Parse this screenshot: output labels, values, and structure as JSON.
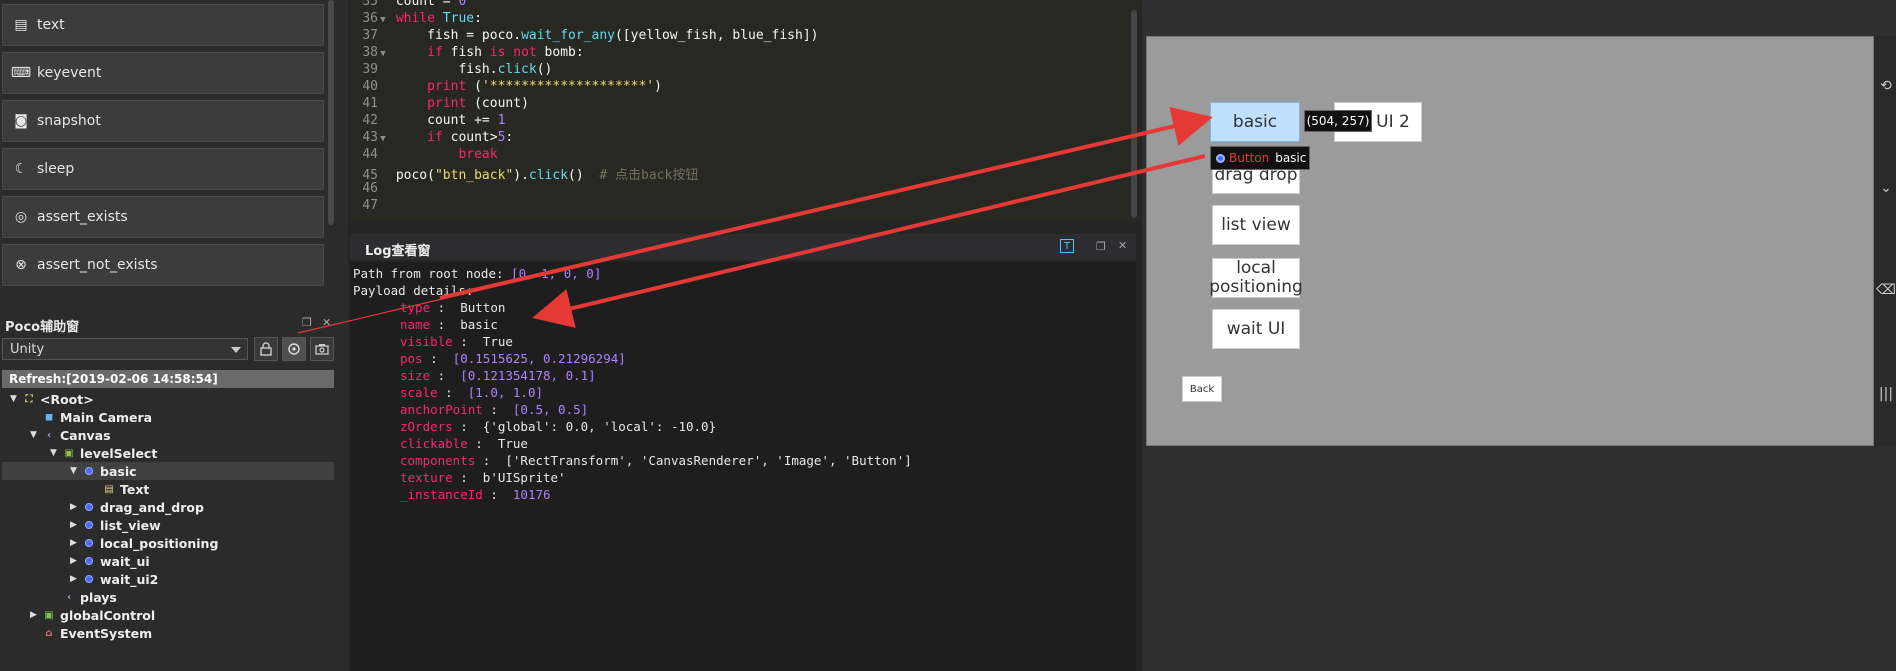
{
  "sidebar": {
    "commands": [
      {
        "label": "text",
        "icon": "text-icon"
      },
      {
        "label": "keyevent",
        "icon": "keyboard-icon"
      },
      {
        "label": "snapshot",
        "icon": "camera-icon"
      },
      {
        "label": "sleep",
        "icon": "moon-icon"
      },
      {
        "label": "assert_exists",
        "icon": "target-icon"
      },
      {
        "label": "assert_not_exists",
        "icon": "cross-circle-icon"
      }
    ]
  },
  "poco": {
    "title": "Poco辅助窗",
    "engine": "Unity",
    "refresh": "Refresh:[2019-02-06 14:58:54]",
    "tree": [
      {
        "label": "<Root>",
        "depth": 0,
        "toggle": "▼",
        "icon": "root-icon"
      },
      {
        "label": "Main Camera",
        "depth": 1,
        "toggle": "",
        "icon": "camera-node-icon"
      },
      {
        "label": "Canvas",
        "depth": 1,
        "toggle": "▼",
        "icon": "canvas-icon"
      },
      {
        "label": "levelSelect",
        "depth": 2,
        "toggle": "▼",
        "icon": "image-node-icon"
      },
      {
        "label": "basic",
        "depth": 3,
        "toggle": "▼",
        "icon": "button-node-icon"
      },
      {
        "label": "Text",
        "depth": 4,
        "toggle": "",
        "icon": "text-node-icon"
      },
      {
        "label": "drag_and_drop",
        "depth": 3,
        "toggle": "▶",
        "icon": "button-node-icon"
      },
      {
        "label": "list_view",
        "depth": 3,
        "toggle": "▶",
        "icon": "button-node-icon"
      },
      {
        "label": "local_positioning",
        "depth": 3,
        "toggle": "▶",
        "icon": "button-node-icon"
      },
      {
        "label": "wait_ui",
        "depth": 3,
        "toggle": "▶",
        "icon": "button-node-icon"
      },
      {
        "label": "wait_ui2",
        "depth": 3,
        "toggle": "▶",
        "icon": "button-node-icon"
      },
      {
        "label": "plays",
        "depth": 2,
        "toggle": "",
        "icon": "canvas-icon"
      },
      {
        "label": "globalControl",
        "depth": 1,
        "toggle": "▶",
        "icon": "image-node-icon"
      },
      {
        "label": "EventSystem",
        "depth": 1,
        "toggle": "",
        "icon": "event-icon"
      }
    ]
  },
  "code": {
    "lines": [
      {
        "n": "35",
        "fold": "",
        "html": "<span class=\"tx\">count = </span><span class=\"nm\">0</span>"
      },
      {
        "n": "36",
        "fold": "▼",
        "html": "<span class=\"kw\">while</span><span class=\"tx\"> </span><span class=\"fn\">True</span><span class=\"tx\">:</span>"
      },
      {
        "n": "37",
        "fold": "",
        "html": "<span class=\"tx\">    fish = poco.</span><span class=\"fn\">wait_for_any</span><span class=\"tx\">([yellow_fish, blue_fish])</span>"
      },
      {
        "n": "38",
        "fold": "▼",
        "html": "<span class=\"tx\">    </span><span class=\"kw\">if</span><span class=\"tx\"> fish </span><span class=\"kw\">is not</span><span class=\"tx\"> bomb:</span>"
      },
      {
        "n": "39",
        "fold": "",
        "html": "<span class=\"tx\">        fish.</span><span class=\"fn\">click</span><span class=\"tx\">()</span>"
      },
      {
        "n": "40",
        "fold": "",
        "html": "<span class=\"tx\">    </span><span class=\"kw\">print</span><span class=\"tx\"> (</span><span class=\"st\">'********************'</span><span class=\"tx\">)</span>"
      },
      {
        "n": "41",
        "fold": "",
        "html": "<span class=\"tx\">    </span><span class=\"kw\">print</span><span class=\"tx\"> (count)</span>"
      },
      {
        "n": "42",
        "fold": "",
        "html": "<span class=\"tx\">    count += </span><span class=\"nm\">1</span>"
      },
      {
        "n": "43",
        "fold": "▼",
        "html": "<span class=\"tx\">    </span><span class=\"kw\">if</span><span class=\"tx\"> count></span><span class=\"nm\">5</span><span class=\"tx\">:</span>"
      },
      {
        "n": "44",
        "fold": "",
        "html": "<span class=\"tx\">        </span><span class=\"kw\">break</span>"
      },
      {
        "n": "45",
        "fold": "",
        "html": "<span class=\"tx\">poco(</span><span class=\"st\">\"btn_back\"</span><span class=\"tx\">).</span><span class=\"fn\">click</span><span class=\"tx\">()  </span><span class=\"cm\"># 点击back按钮</span>"
      },
      {
        "n": "46",
        "fold": "",
        "html": ""
      },
      {
        "n": "47",
        "fold": "",
        "html": ""
      }
    ]
  },
  "log": {
    "title": "Log查看窗",
    "path_label": "Path from root node: ",
    "path_value": "[0, 1, 0, 0]",
    "payload_label": "Payload details:",
    "fields": [
      {
        "key": "type",
        "value": "Button",
        "kind": "text"
      },
      {
        "key": "name",
        "value": "basic",
        "kind": "text"
      },
      {
        "key": "visible",
        "value": "True",
        "kind": "text"
      },
      {
        "key": "pos",
        "value": "[0.1515625, 0.21296294]",
        "kind": "num"
      },
      {
        "key": "size",
        "value": "[0.121354178, 0.1]",
        "kind": "num"
      },
      {
        "key": "scale",
        "value": "[1.0, 1.0]",
        "kind": "num"
      },
      {
        "key": "anchorPoint",
        "value": "[0.5, 0.5]",
        "kind": "num"
      },
      {
        "key": "zOrders",
        "value": "{'global': 0.0, 'local': -10.0}",
        "kind": "text"
      },
      {
        "key": "clickable",
        "value": "True",
        "kind": "text"
      },
      {
        "key": "components",
        "value": "['RectTransform', 'CanvasRenderer', 'Image', 'Button']",
        "kind": "text"
      },
      {
        "key": "texture",
        "value": "b'UISprite'",
        "kind": "text"
      },
      {
        "key": "_instanceId",
        "value": "10176",
        "kind": "num"
      }
    ]
  },
  "device": {
    "buttons": {
      "basic": "basic",
      "ui2": "UI 2",
      "drag_drop": "drag drop",
      "list_view": "list view",
      "local_positioning_1": "local",
      "local_positioning_2": "positioning",
      "wait_ui": "wait UI",
      "back": "Back"
    },
    "tooltip": "(504, 257)",
    "hover_type": "Button",
    "hover_name": "basic"
  },
  "colors": {
    "arrow": "#e53935",
    "selected_button": "#bfe0ff"
  }
}
